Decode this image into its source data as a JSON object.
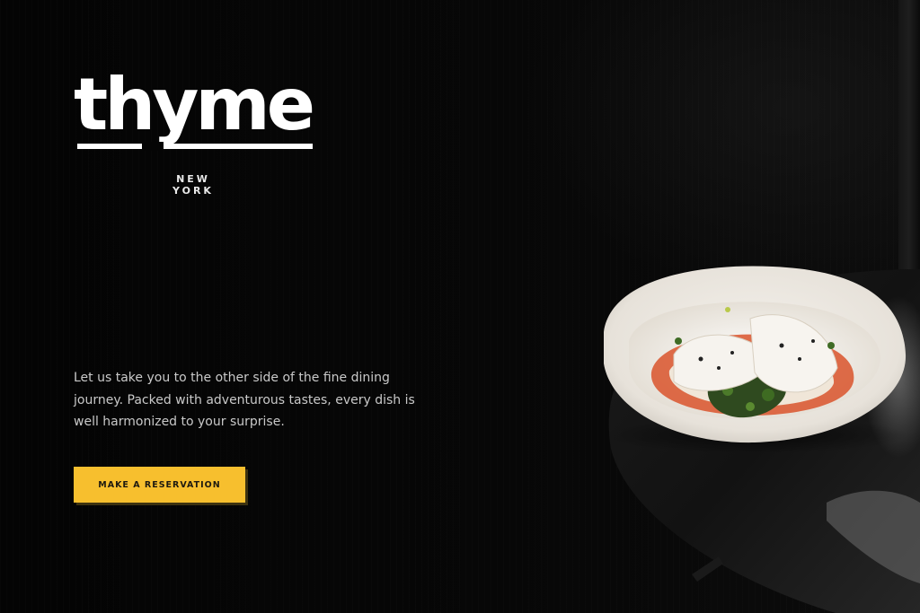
{
  "brand": {
    "name": "thyme",
    "location": "NEW YORK"
  },
  "hero": {
    "intro": "Let us take you to the other side of the fine dining journey. Packed with adventurous tastes, every dish is well harmonized to your surprise.",
    "cta_label": "MAKE A RESERVATION"
  },
  "colors": {
    "background": "#050505",
    "accent": "#f7bf2e",
    "text": "#ffffff"
  },
  "icons": {
    "hero_image": "plated-dish-photo"
  }
}
